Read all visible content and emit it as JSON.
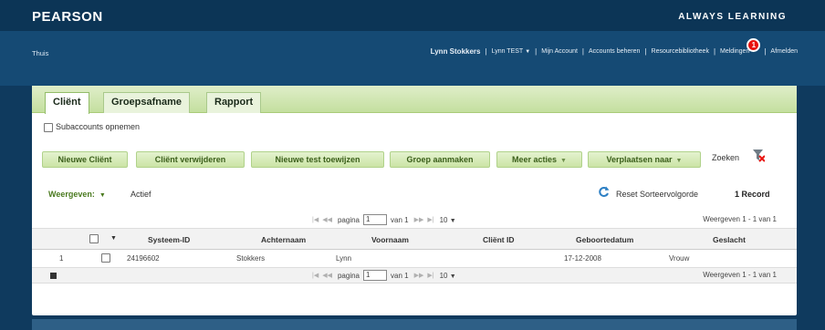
{
  "header": {
    "brand": "PEARSON",
    "tagline": "ALWAYS LEARNING"
  },
  "nav": {
    "home": "Thuis",
    "user_name": "Lynn Stokkers",
    "account": "Lynn TEST",
    "items": [
      "Mijn Account",
      "Accounts beheren",
      "Resourcebibliotheek",
      "Meldingen"
    ],
    "notifications_count": "1",
    "logout": "Afmelden"
  },
  "tabs": [
    "Cliënt",
    "Groepsafname",
    "Rapport"
  ],
  "subaccounts_label": "Subaccounts opnemen",
  "toolbar": {
    "buttons": [
      "Nieuwe Cliënt",
      "Cliënt verwijderen",
      "Nieuwe test toewijzen",
      "Groep aanmaken"
    ],
    "more_actions": "Meer acties",
    "move_to": "Verplaatsen naar",
    "search": "Zoeken"
  },
  "view": {
    "label": "Weergeven:",
    "value": "Actief",
    "reset": "Reset Sorteervolgorde",
    "record_count": "1 Record"
  },
  "pager": {
    "page_label": "pagina",
    "page": "1",
    "of_label": "van 1",
    "page_size": "10",
    "info": "Weergeven 1 - 1 van 1"
  },
  "table": {
    "columns": [
      "Systeem-ID",
      "Achternaam",
      "Voornaam",
      "Cliënt ID",
      "Geboortedatum",
      "Geslacht"
    ],
    "rows": [
      {
        "index": "1",
        "system_id": "24196602",
        "last_name": "Stokkers",
        "first_name": "Lynn",
        "client_id": "",
        "birth_date": "17-12-2008",
        "gender": "Vrouw"
      }
    ]
  },
  "colors": {
    "brand_dark": "#0c3556",
    "nav_blue": "#154a74",
    "accent_green": "#c4df9f",
    "alert_red": "#e8130f"
  }
}
